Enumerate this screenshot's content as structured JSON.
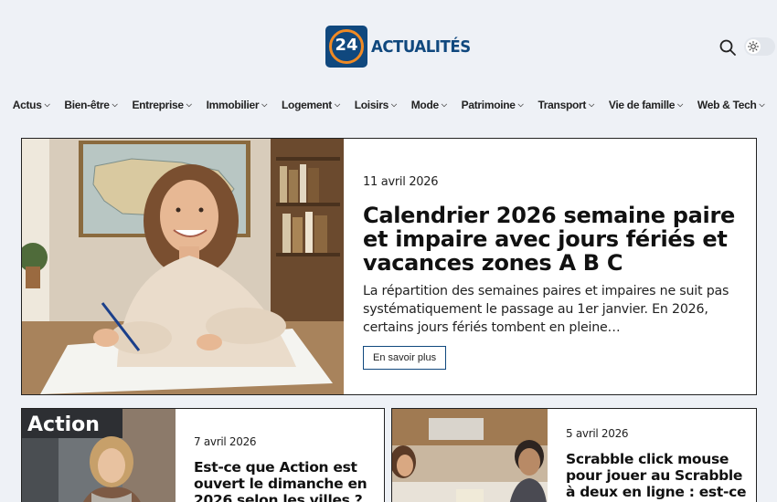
{
  "brand": {
    "logo_number": "24",
    "logo_text": "ACTUALITÉS"
  },
  "header": {
    "search_icon": "search-icon",
    "theme_icon": "sun-icon"
  },
  "nav": [
    {
      "label": "Actus"
    },
    {
      "label": "Bien-être"
    },
    {
      "label": "Entreprise"
    },
    {
      "label": "Immobilier"
    },
    {
      "label": "Logement"
    },
    {
      "label": "Loisirs"
    },
    {
      "label": "Mode"
    },
    {
      "label": "Patrimoine"
    },
    {
      "label": "Transport"
    },
    {
      "label": "Vie de famille"
    },
    {
      "label": "Web & Tech"
    }
  ],
  "hero": {
    "date": "11 avril 2026",
    "title": "Calendrier 2026 semaine paire et impaire avec jours fériés et vacances zones A B C",
    "excerpt": "La répartition des semaines paires et impaires ne suit pas systématiquement le passage au 1er janvier. En 2026, certains jours fériés tombent en pleine…",
    "button_label": "En savoir plus"
  },
  "cards": [
    {
      "date": "7 avril 2026",
      "title": "Est-ce que Action est ouvert le dimanche en 2026 selon les villes ?",
      "image_sign": "Action"
    },
    {
      "date": "5 avril 2026",
      "title": "Scrabble click mouse pour jouer au Scrabble à deux en ligne : est-ce possible ?"
    }
  ],
  "colors": {
    "brand_blue": "#10487e",
    "brand_orange": "#f08a24",
    "background": "#eef1f6"
  }
}
